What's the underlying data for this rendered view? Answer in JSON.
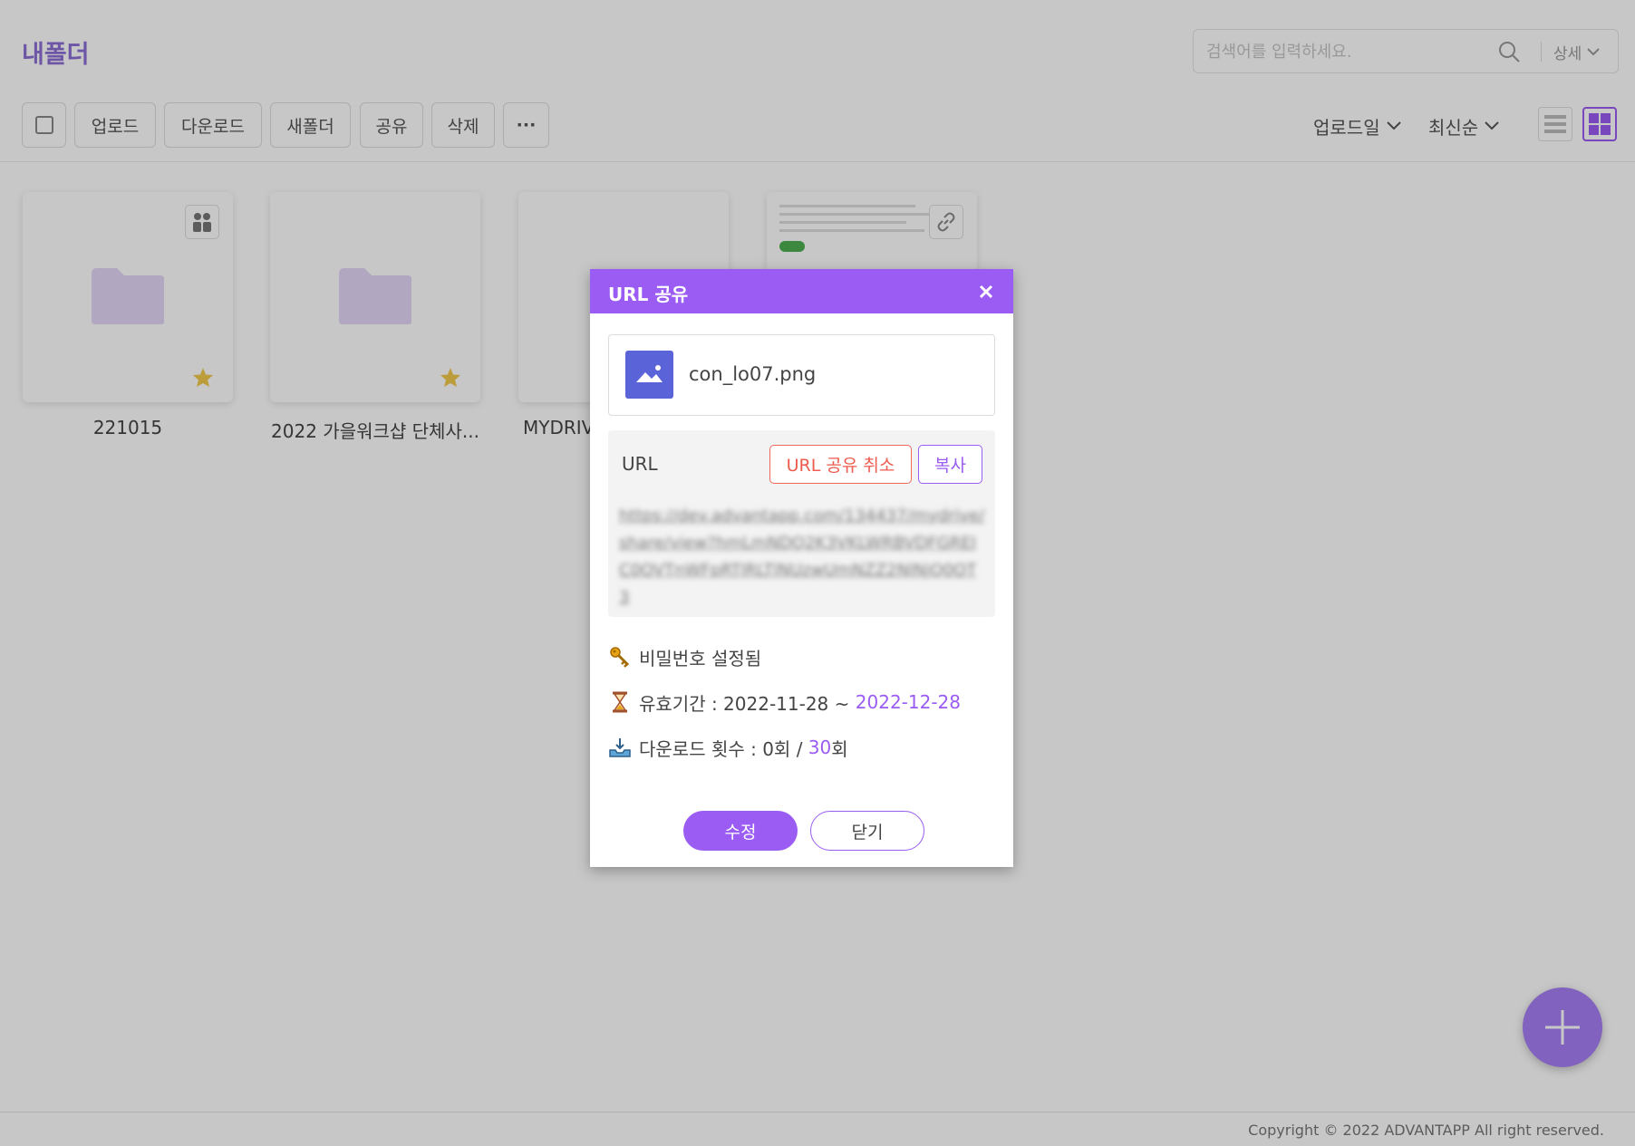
{
  "header": {
    "title": "내폴더",
    "search_placeholder": "검색어를 입력하세요.",
    "detail_label": "상세"
  },
  "toolbar": {
    "upload_label": "업로드",
    "download_label": "다운로드",
    "new_folder_label": "새폴더",
    "share_label": "공유",
    "delete_label": "삭제",
    "more_label": "···",
    "sort_field_label": "업로드일",
    "sort_order_label": "최신순"
  },
  "files": [
    {
      "name": "221015",
      "type": "folder",
      "shared": true,
      "favorite": true
    },
    {
      "name": "2022 가을워크샵 단체사...",
      "type": "folder",
      "shared": false,
      "favorite": true
    },
    {
      "name": "MYDRIV",
      "type": "folder",
      "shared": false,
      "favorite": false
    },
    {
      "name": "",
      "type": "file",
      "url_shared": true,
      "favorite": false
    }
  ],
  "modal": {
    "title": "URL 공유",
    "file_name": "con_lo07.png",
    "url_label": "URL",
    "cancel_share_label": "URL 공유 취소",
    "copy_label": "복사",
    "url_text": "https://dev.advantapp.com/134437/mydrive/share/view?hmLmNDQ2K3VKLWRBVDFGREIC0OVTnWFpRTlRLTlNUzwUmNZZ2NlNjQ0OT3",
    "password_label": "비밀번호 설정됨",
    "period_label": "유효기간 : 2022-11-28 ~ ",
    "period_end": "2022-12-28",
    "download_count_label": "다운로드 횟수 : 0회 / ",
    "download_limit": "30",
    "download_limit_suffix": "회",
    "edit_label": "수정",
    "close_label": "닫기"
  },
  "footer": {
    "copyright": "Copyright © 2022 ADVANTAPP All right reserved."
  },
  "colors": {
    "accent": "#9a5cf2",
    "title_purple": "#8e6fd6",
    "danger": "#ee5b4f",
    "thumb_blue": "#5b63d8",
    "folder": "#e4d6f8",
    "star": "#f2c94c"
  }
}
